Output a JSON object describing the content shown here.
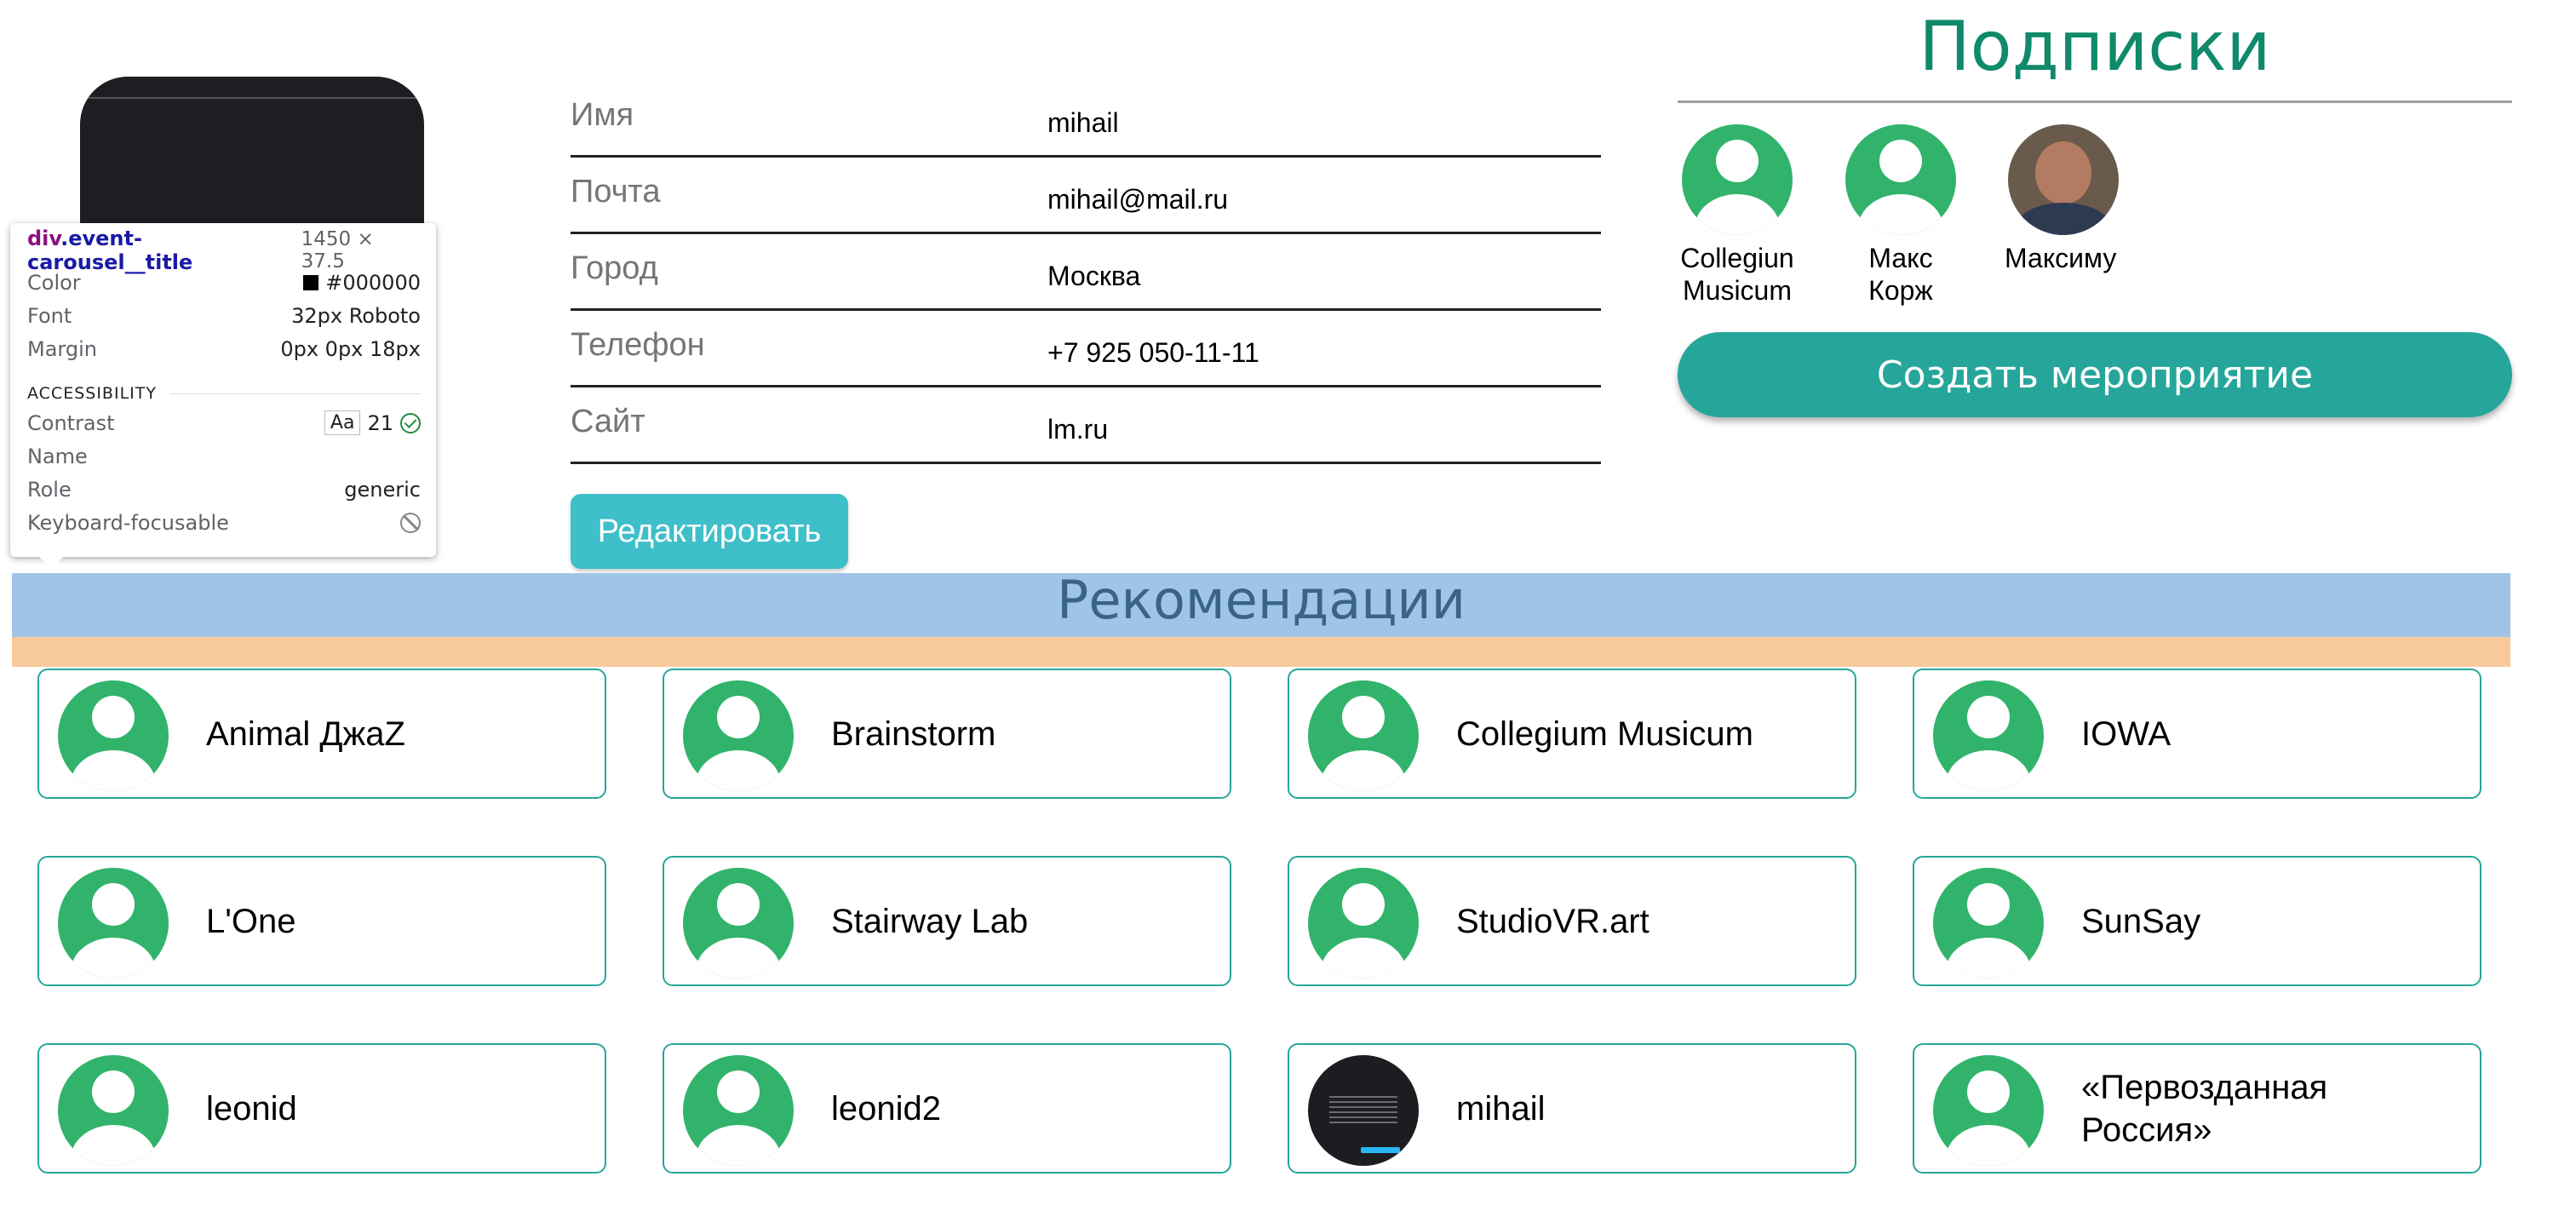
{
  "tooltip": {
    "tag": "div",
    "class": ".event-carousel__title",
    "size": "1450 × 37.5",
    "rows": [
      {
        "label": "Color",
        "value": "#000000"
      },
      {
        "label": "Font",
        "value": "32px Roboto"
      },
      {
        "label": "Margin",
        "value": "0px 0px 18px"
      }
    ],
    "accessibility_heading": "ACCESSIBILITY",
    "contrast_label": "Contrast",
    "contrast_aa": "Aa",
    "contrast_value": "21",
    "name_label": "Name",
    "role_label": "Role",
    "role_value": "generic",
    "focus_label": "Keyboard-focusable"
  },
  "profile": {
    "fields": [
      {
        "label": "Имя",
        "value": "mihail"
      },
      {
        "label": "Почта",
        "value": "mihail@mail.ru"
      },
      {
        "label": "Город",
        "value": "Москва"
      },
      {
        "label": "Телефон",
        "value": "+7 925 050-11-11"
      },
      {
        "label": "Сайт",
        "value": "lm.ru"
      }
    ],
    "edit_button": "Редактировать"
  },
  "subscriptions": {
    "title": "Подписки",
    "items": [
      {
        "line1": "Collegiun",
        "line2": "Musicum",
        "avatar": "person-icon"
      },
      {
        "line1": "Макс",
        "line2": "Корж",
        "avatar": "person-icon"
      },
      {
        "line1": "Максиму",
        "line2": "",
        "avatar": "photo"
      }
    ],
    "create_button": "Создать мероприятие"
  },
  "recommendations": {
    "title": "Рекомендации",
    "items": [
      {
        "name": "Animal ДжаZ",
        "avatar": "person-icon"
      },
      {
        "name": "Brainstorm",
        "avatar": "person-icon"
      },
      {
        "name": "Collegium Musicum",
        "avatar": "person-icon"
      },
      {
        "name": "IOWA",
        "avatar": "person-icon"
      },
      {
        "name": "L'One",
        "avatar": "person-icon"
      },
      {
        "name": "Stairway Lab",
        "avatar": "person-icon"
      },
      {
        "name": "StudioVR.art",
        "avatar": "person-icon"
      },
      {
        "name": "SunSay",
        "avatar": "person-icon"
      },
      {
        "name": "leonid",
        "avatar": "person-icon"
      },
      {
        "name": "leonid2",
        "avatar": "person-icon"
      },
      {
        "name": "mihail",
        "avatar": "screenshot"
      },
      {
        "name": "«Первозданная Россия»",
        "avatar": "person-icon"
      }
    ]
  },
  "colors": {
    "accent_teal": "#26a69a",
    "edit_button": "#3fbfc9",
    "avatar_green": "#31b36b",
    "subs_title": "#0f8a6b",
    "rec_band_blue": "#a0c4e8",
    "rec_band_orange": "#f8ca9b"
  }
}
